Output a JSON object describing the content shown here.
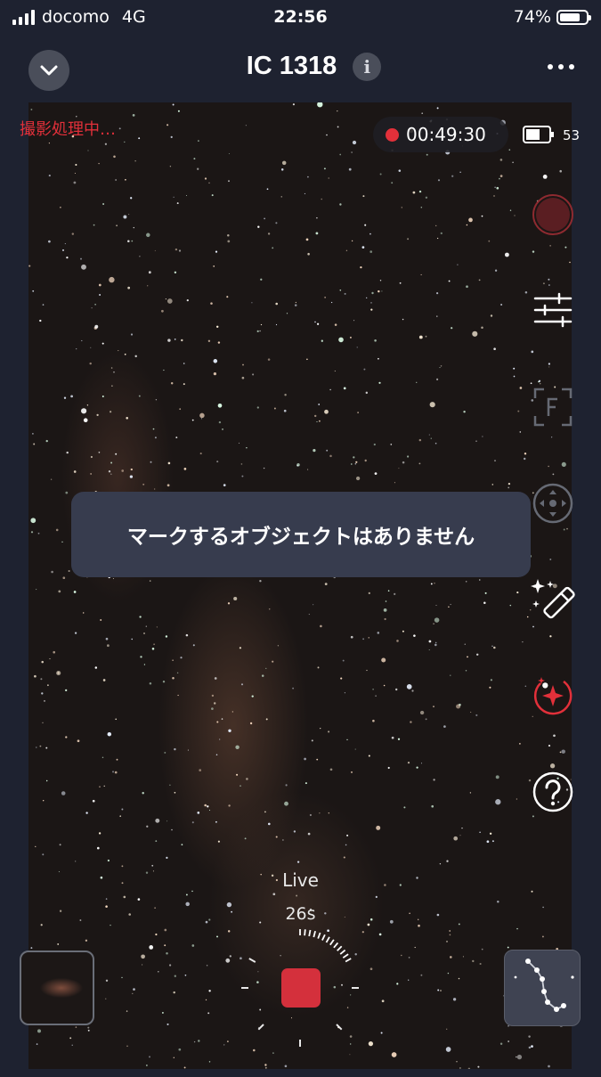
{
  "status_bar": {
    "carrier": "docomo",
    "network": "4G",
    "time": "22:56",
    "battery": "74%"
  },
  "nav": {
    "title": "IC 1318"
  },
  "capture": {
    "processing_text": "撮影処理中…",
    "elapsed": "00:49:30",
    "device_battery": "53"
  },
  "side_tools": [
    {
      "name": "record-button-icon"
    },
    {
      "name": "sliders-icon"
    },
    {
      "name": "focus-f-icon"
    },
    {
      "name": "calibrate-icon"
    },
    {
      "name": "magic-wand-icon"
    },
    {
      "name": "sparkle-annotation-icon"
    },
    {
      "name": "help-icon"
    }
  ],
  "toast": {
    "message": "マークするオブジェクトはありません"
  },
  "live": {
    "label": "Live",
    "exposure": "26s"
  },
  "colors": {
    "accent_red": "#e2303a",
    "stop_red": "#d4303c",
    "toast_bg": "#373c4e",
    "nav_bg": "#1e2230"
  }
}
